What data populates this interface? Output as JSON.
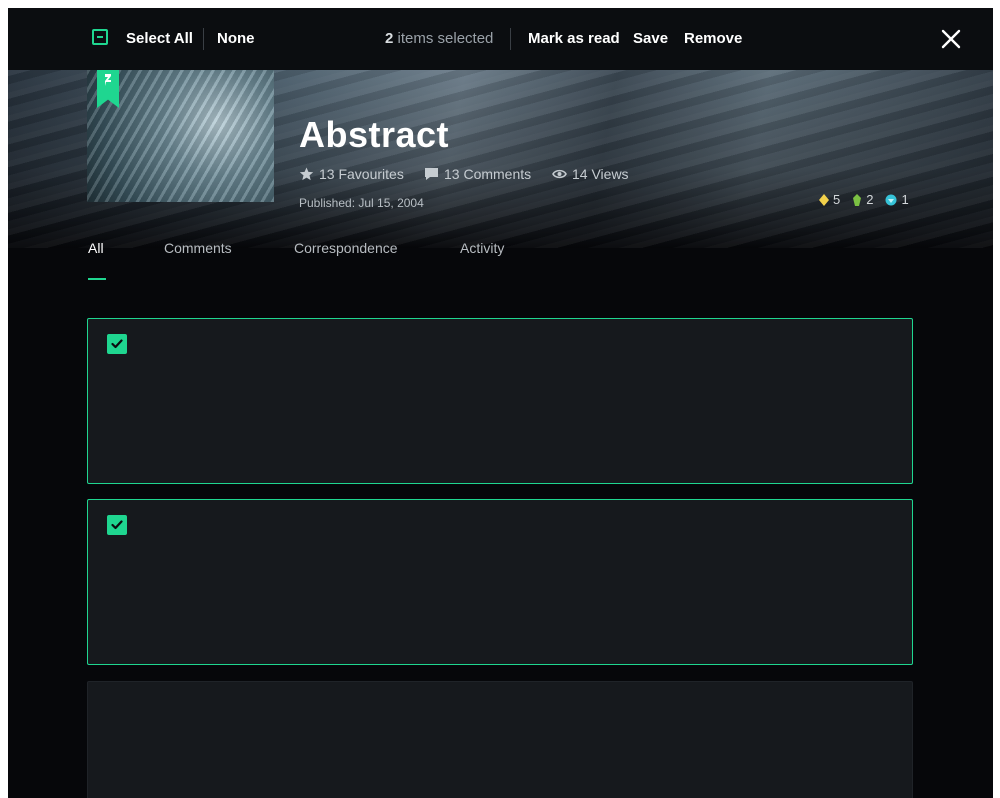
{
  "selection_bar": {
    "select_all_label": "Select All",
    "none_label": "None",
    "count": "2",
    "count_suffix": "items selected",
    "mark_as_read_label": "Mark as read",
    "save_label": "Save",
    "remove_label": "Remove",
    "close_icon": "close-icon"
  },
  "deviation": {
    "title": "Abstract",
    "favourites": "13 Favourites",
    "comments": "13 Comments",
    "views": "14 Views",
    "published": "Published: Jul 15, 2004",
    "awards": [
      {
        "icon": "gold-badge-icon",
        "count": "5",
        "color": "#f2d14b"
      },
      {
        "icon": "green-badge-icon",
        "count": "2",
        "color": "#7bc043"
      },
      {
        "icon": "blue-badge-icon",
        "count": "1",
        "color": "#36c3d8"
      }
    ]
  },
  "tabs": [
    {
      "label": "All",
      "active": true
    },
    {
      "label": "Comments",
      "active": false
    },
    {
      "label": "Correspondence",
      "active": false
    },
    {
      "label": "Activity",
      "active": false
    }
  ],
  "items": [
    {
      "selected": true
    },
    {
      "selected": true
    },
    {
      "selected": false
    }
  ],
  "colors": {
    "accent": "#1fd690",
    "background": "#06070a",
    "card": "#16191d"
  }
}
